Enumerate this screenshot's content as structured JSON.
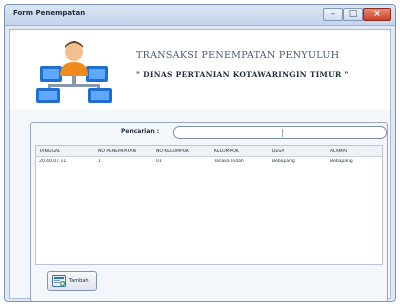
{
  "window": {
    "title": "Form Penempatan",
    "controls": {
      "minimize": "–",
      "maximize": "□",
      "close": "×"
    }
  },
  "header": {
    "title": "TRANSAKSI PENEMPATAN PENYULUH",
    "subtitle": "\" DINAS PERTANIAN KOTAWARINGIN TIMUR \"",
    "logo_icon": "network-users-icon"
  },
  "search": {
    "label": "Pencarian :",
    "value": ""
  },
  "table": {
    "columns": [
      "TANGGAL",
      "NO PENEMPATAN",
      "NO KELOMPOK",
      "KELOMPOK",
      "DESA",
      "ALAMAT"
    ],
    "rows": [
      [
        "20.40.07.11",
        "1",
        "01",
        "Tanaka Indah",
        "Bebapang",
        "Bebapang"
      ]
    ]
  },
  "buttons": {
    "add_label": "Tambah",
    "add_icon": "add-record-icon"
  },
  "colors": {
    "window_frame": "#dfe8f4",
    "close_button": "#c9412a",
    "header_text": "#455a74"
  }
}
